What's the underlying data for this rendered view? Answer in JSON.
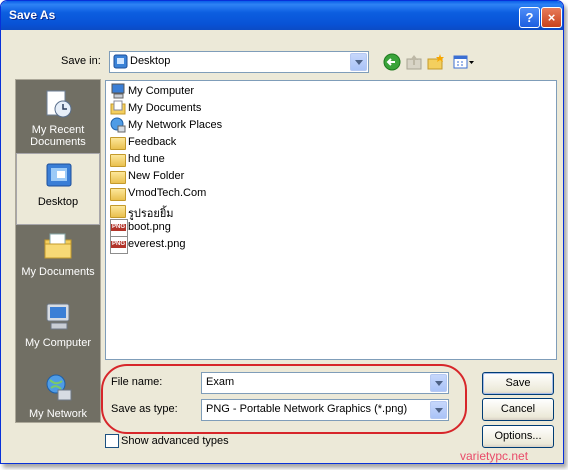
{
  "window": {
    "title": "Save As",
    "help_glyph": "?",
    "close_glyph": "×"
  },
  "toolbar": {
    "save_in_label": "Save in:",
    "save_in_value": "Desktop",
    "icons": [
      "back-icon",
      "up-folder-icon",
      "new-folder-icon",
      "view-menu-icon"
    ]
  },
  "places": [
    {
      "label": "My Recent Documents",
      "icon": "recent-documents-icon",
      "selected": false
    },
    {
      "label": "Desktop",
      "icon": "desktop-icon",
      "selected": true
    },
    {
      "label": "My Documents",
      "icon": "my-documents-icon",
      "selected": false
    },
    {
      "label": "My Computer",
      "icon": "my-computer-icon",
      "selected": false
    },
    {
      "label": "My Network",
      "icon": "my-network-icon",
      "selected": false
    }
  ],
  "files": [
    {
      "name": "My Computer",
      "icon": "computer-icon"
    },
    {
      "name": "My Documents",
      "icon": "documents-folder-icon"
    },
    {
      "name": "My Network Places",
      "icon": "network-places-icon"
    },
    {
      "name": "Feedback",
      "icon": "folder-icon"
    },
    {
      "name": "hd tune",
      "icon": "folder-icon"
    },
    {
      "name": "New Folder",
      "icon": "folder-icon"
    },
    {
      "name": "VmodTech.Com",
      "icon": "folder-icon"
    },
    {
      "name": "รูปรอยยิ้ม",
      "icon": "folder-icon"
    },
    {
      "name": "boot.png",
      "icon": "png-file-icon"
    },
    {
      "name": "everest.png",
      "icon": "png-file-icon"
    }
  ],
  "form": {
    "file_name_label": "File name:",
    "file_name_value": "Exam",
    "save_type_label": "Save as type:",
    "save_type_value": "PNG - Portable Network Graphics (*.png)",
    "advanced_label": "Show advanced types",
    "advanced_checked": false
  },
  "buttons": {
    "save": "Save",
    "cancel": "Cancel",
    "options": "Options..."
  },
  "watermark": "varietypc.net"
}
